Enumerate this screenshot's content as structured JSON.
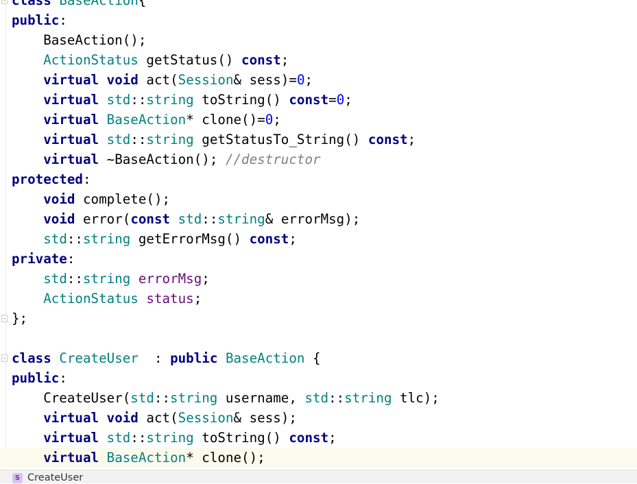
{
  "editor": {
    "lines": [
      {
        "tokens": [
          {
            "t": "class",
            "k": "kw"
          },
          {
            "t": " ",
            "k": "pl"
          },
          {
            "t": "BaseAction",
            "k": "ty"
          },
          {
            "t": "{",
            "k": "pl"
          }
        ]
      },
      {
        "tokens": [
          {
            "t": "public",
            "k": "kw"
          },
          {
            "t": ":",
            "k": "pl"
          }
        ]
      },
      {
        "tokens": [
          {
            "t": "    BaseAction();",
            "k": "pl"
          }
        ]
      },
      {
        "tokens": [
          {
            "t": "    ",
            "k": "pl"
          },
          {
            "t": "ActionStatus",
            "k": "ty"
          },
          {
            "t": " getStatus() ",
            "k": "pl"
          },
          {
            "t": "const",
            "k": "kw"
          },
          {
            "t": ";",
            "k": "pl"
          }
        ]
      },
      {
        "tokens": [
          {
            "t": "    ",
            "k": "pl"
          },
          {
            "t": "virtual",
            "k": "kw"
          },
          {
            "t": " ",
            "k": "pl"
          },
          {
            "t": "void",
            "k": "kw"
          },
          {
            "t": " act(",
            "k": "pl"
          },
          {
            "t": "Session",
            "k": "ty"
          },
          {
            "t": "& sess)=",
            "k": "pl"
          },
          {
            "t": "0",
            "k": "num"
          },
          {
            "t": ";",
            "k": "pl"
          }
        ]
      },
      {
        "tokens": [
          {
            "t": "    ",
            "k": "pl"
          },
          {
            "t": "virtual",
            "k": "kw"
          },
          {
            "t": " ",
            "k": "pl"
          },
          {
            "t": "std",
            "k": "ty"
          },
          {
            "t": "::",
            "k": "pl"
          },
          {
            "t": "string",
            "k": "ty"
          },
          {
            "t": " toString() ",
            "k": "pl"
          },
          {
            "t": "const",
            "k": "kw"
          },
          {
            "t": "=",
            "k": "pl"
          },
          {
            "t": "0",
            "k": "num"
          },
          {
            "t": ";",
            "k": "pl"
          }
        ]
      },
      {
        "tokens": [
          {
            "t": "    ",
            "k": "pl"
          },
          {
            "t": "virtual",
            "k": "kw"
          },
          {
            "t": " ",
            "k": "pl"
          },
          {
            "t": "BaseAction",
            "k": "ty"
          },
          {
            "t": "* clone()=",
            "k": "pl"
          },
          {
            "t": "0",
            "k": "num"
          },
          {
            "t": ";",
            "k": "pl"
          }
        ]
      },
      {
        "tokens": [
          {
            "t": "    ",
            "k": "pl"
          },
          {
            "t": "virtual",
            "k": "kw"
          },
          {
            "t": " ",
            "k": "pl"
          },
          {
            "t": "std",
            "k": "ty"
          },
          {
            "t": "::",
            "k": "pl"
          },
          {
            "t": "string",
            "k": "ty"
          },
          {
            "t": " getStatusTo_String() ",
            "k": "pl"
          },
          {
            "t": "const",
            "k": "kw"
          },
          {
            "t": ";",
            "k": "pl"
          }
        ]
      },
      {
        "tokens": [
          {
            "t": "    ",
            "k": "pl"
          },
          {
            "t": "virtual",
            "k": "kw"
          },
          {
            "t": " ~BaseAction(); ",
            "k": "pl"
          },
          {
            "t": "//destructor",
            "k": "cmt"
          }
        ]
      },
      {
        "tokens": [
          {
            "t": "protected",
            "k": "kw"
          },
          {
            "t": ":",
            "k": "pl"
          }
        ]
      },
      {
        "tokens": [
          {
            "t": "    ",
            "k": "pl"
          },
          {
            "t": "void",
            "k": "kw"
          },
          {
            "t": " complete();",
            "k": "pl"
          }
        ]
      },
      {
        "tokens": [
          {
            "t": "    ",
            "k": "pl"
          },
          {
            "t": "void",
            "k": "kw"
          },
          {
            "t": " error(",
            "k": "pl"
          },
          {
            "t": "const",
            "k": "kw"
          },
          {
            "t": " ",
            "k": "pl"
          },
          {
            "t": "std",
            "k": "ty"
          },
          {
            "t": "::",
            "k": "pl"
          },
          {
            "t": "string",
            "k": "ty"
          },
          {
            "t": "& errorMsg);",
            "k": "pl"
          }
        ]
      },
      {
        "tokens": [
          {
            "t": "    ",
            "k": "pl"
          },
          {
            "t": "std",
            "k": "ty"
          },
          {
            "t": "::",
            "k": "pl"
          },
          {
            "t": "string",
            "k": "ty"
          },
          {
            "t": " getErrorMsg() ",
            "k": "pl"
          },
          {
            "t": "const",
            "k": "kw"
          },
          {
            "t": ";",
            "k": "pl"
          }
        ]
      },
      {
        "tokens": [
          {
            "t": "private",
            "k": "kw"
          },
          {
            "t": ":",
            "k": "pl"
          }
        ]
      },
      {
        "tokens": [
          {
            "t": "    ",
            "k": "pl"
          },
          {
            "t": "std",
            "k": "ty"
          },
          {
            "t": "::",
            "k": "pl"
          },
          {
            "t": "string",
            "k": "ty"
          },
          {
            "t": " ",
            "k": "pl"
          },
          {
            "t": "errorMsg",
            "k": "fld"
          },
          {
            "t": ";",
            "k": "pl"
          }
        ]
      },
      {
        "tokens": [
          {
            "t": "    ",
            "k": "pl"
          },
          {
            "t": "ActionStatus",
            "k": "ty"
          },
          {
            "t": " ",
            "k": "pl"
          },
          {
            "t": "status",
            "k": "fld"
          },
          {
            "t": ";",
            "k": "pl"
          }
        ]
      },
      {
        "tokens": [
          {
            "t": "};",
            "k": "pl"
          }
        ]
      },
      {
        "tokens": []
      },
      {
        "tokens": [
          {
            "t": "class",
            "k": "kw"
          },
          {
            "t": " ",
            "k": "pl"
          },
          {
            "t": "CreateUser",
            "k": "ty"
          },
          {
            "t": "  : ",
            "k": "pl"
          },
          {
            "t": "public",
            "k": "kw"
          },
          {
            "t": " ",
            "k": "pl"
          },
          {
            "t": "BaseAction",
            "k": "ty"
          },
          {
            "t": " {",
            "k": "pl"
          }
        ]
      },
      {
        "tokens": [
          {
            "t": "public",
            "k": "kw"
          },
          {
            "t": ":",
            "k": "pl"
          }
        ]
      },
      {
        "tokens": [
          {
            "t": "    CreateUser(",
            "k": "pl"
          },
          {
            "t": "std",
            "k": "ty"
          },
          {
            "t": "::",
            "k": "pl"
          },
          {
            "t": "string",
            "k": "ty"
          },
          {
            "t": " username, ",
            "k": "pl"
          },
          {
            "t": "std",
            "k": "ty"
          },
          {
            "t": "::",
            "k": "pl"
          },
          {
            "t": "string",
            "k": "ty"
          },
          {
            "t": " tlc);",
            "k": "pl"
          }
        ]
      },
      {
        "tokens": [
          {
            "t": "    ",
            "k": "pl"
          },
          {
            "t": "virtual",
            "k": "kw"
          },
          {
            "t": " ",
            "k": "pl"
          },
          {
            "t": "void",
            "k": "kw"
          },
          {
            "t": " act(",
            "k": "pl"
          },
          {
            "t": "Session",
            "k": "ty"
          },
          {
            "t": "& sess);",
            "k": "pl"
          }
        ]
      },
      {
        "tokens": [
          {
            "t": "    ",
            "k": "pl"
          },
          {
            "t": "virtual",
            "k": "kw"
          },
          {
            "t": " ",
            "k": "pl"
          },
          {
            "t": "std",
            "k": "ty"
          },
          {
            "t": "::",
            "k": "pl"
          },
          {
            "t": "string",
            "k": "ty"
          },
          {
            "t": " toString() ",
            "k": "pl"
          },
          {
            "t": "const",
            "k": "kw"
          },
          {
            "t": ";",
            "k": "pl"
          }
        ]
      },
      {
        "tokens": [
          {
            "t": "    ",
            "k": "pl"
          },
          {
            "t": "virtual",
            "k": "kw"
          },
          {
            "t": " ",
            "k": "pl"
          },
          {
            "t": "BaseAction",
            "k": "ty"
          },
          {
            "t": "* clone();",
            "k": "pl"
          }
        ]
      }
    ],
    "current_line": 23,
    "fold_markers": [
      0,
      16,
      18
    ]
  },
  "breadcrumb": {
    "icon": "struct-icon",
    "icon_letter": "S",
    "label": "CreateUser"
  },
  "colors": {
    "keyword": "#000080",
    "type": "#008080",
    "field": "#660e7a",
    "number": "#0000ff",
    "comment": "#808080",
    "current_line_bg": "#fcfaed"
  }
}
